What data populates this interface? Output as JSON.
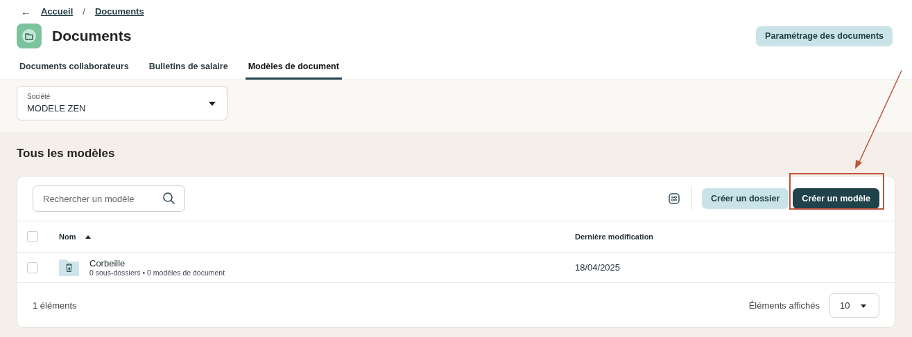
{
  "breadcrumb": {
    "back": "←",
    "items": [
      "Accueil",
      "Documents"
    ],
    "separator": "/"
  },
  "header": {
    "title": "Documents",
    "action": "Paramétrage des documents"
  },
  "tabs": [
    {
      "label": "Documents collaborateurs",
      "selected": false
    },
    {
      "label": "Bulletins de salaire",
      "selected": false
    },
    {
      "label": "Modèles de document",
      "selected": true
    }
  ],
  "company_select": {
    "label": "Société",
    "value": "MODELE ZEN"
  },
  "section_title": "Tous les modèles",
  "toolbar": {
    "search": {
      "placeholder": "Rechercher un modèle"
    },
    "buttons": [
      {
        "label": "Créer un dossier",
        "kind": "secondary"
      },
      {
        "label": "Créer un modèle",
        "kind": "primary"
      }
    ]
  },
  "table": {
    "all_checked": false,
    "columns": [
      {
        "label": "Nom",
        "sorted": true
      },
      {
        "label": "Dernière modification",
        "sorted": false
      }
    ],
    "rows": [
      {
        "name": "Corbeille",
        "details": "0 sous-dossiers • 0 modèles de document",
        "modified": "18/04/2025",
        "checked": false
      }
    ]
  },
  "footer": {
    "count": "1 éléments",
    "page_size_label": "Éléments affichés",
    "page_size": "10"
  }
}
